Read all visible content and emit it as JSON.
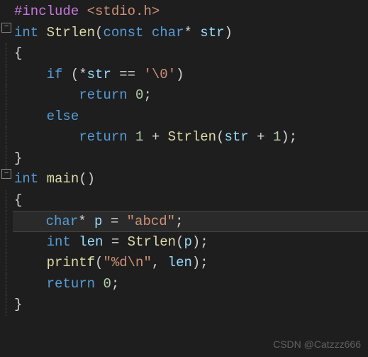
{
  "watermark": "CSDN @Catzzz666",
  "code": {
    "l1": {
      "include": "#include",
      "header": "<stdio.h>"
    },
    "l2": {
      "ret": "int",
      "fn": "Strlen",
      "lp": "(",
      "kwconst": "const",
      "ptype": "char",
      "star": "*",
      "param": "str",
      "rp": ")"
    },
    "l3": {
      "brace": "{"
    },
    "l4": {
      "kwif": "if",
      "lp": "(",
      "deref": "*",
      "v": "str",
      "eq": "==",
      "ch": "'\\0'",
      "rp": ")"
    },
    "l5": {
      "kwret": "return",
      "num": "0",
      "semi": ";"
    },
    "l6": {
      "kwelse": "else"
    },
    "l7": {
      "kwret": "return",
      "one": "1",
      "plus": "+",
      "fn": "Strlen",
      "lp": "(",
      "v": "str",
      "plus2": "+",
      "one2": "1",
      "rp": ")",
      "semi": ";"
    },
    "l8": {
      "brace": "}"
    },
    "l9": {
      "ret": "int",
      "fn": "main",
      "lp": "(",
      "rp": ")"
    },
    "l10": {
      "brace": "{"
    },
    "l11": {
      "type": "char",
      "star": "*",
      "v": "p",
      "eq": "=",
      "str": "\"abcd\"",
      "semi": ";"
    },
    "l12": {
      "type": "int",
      "v": "len",
      "eq": "=",
      "fn": "Strlen",
      "lp": "(",
      "arg": "p",
      "rp": ")",
      "semi": ";"
    },
    "l13": {
      "fn": "printf",
      "lp": "(",
      "fmt": "\"%d\\n\"",
      "comma": ",",
      "arg": "len",
      "rp": ")",
      "semi": ";"
    },
    "l14": {
      "kwret": "return",
      "num": "0",
      "semi": ";"
    },
    "l15": {
      "brace": "}"
    }
  },
  "fold_symbol": "−"
}
